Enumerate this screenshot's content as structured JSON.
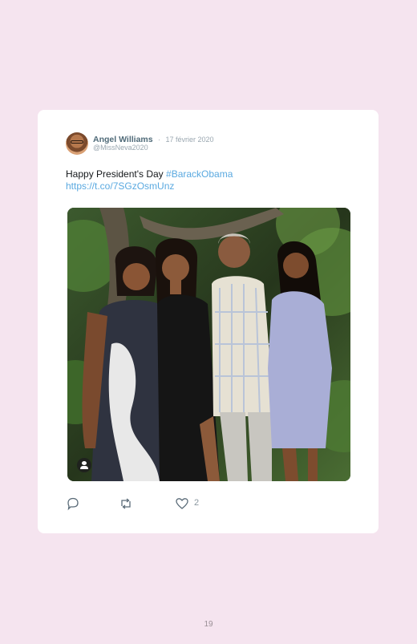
{
  "tweet": {
    "author_name": "Angel Williams",
    "separator": "·",
    "date": "17 février 2020",
    "handle": "@MissNeva2020",
    "text": "Happy President's Day ",
    "hashtag": "#BarackObama",
    "link": "https://t.co/7SGzOsmUnz",
    "like_count": "2"
  },
  "icons": {
    "reply": "reply-icon",
    "retweet": "retweet-icon",
    "like": "heart-icon",
    "tag": "person-tag-icon"
  },
  "colors": {
    "page_background": "#f5e4ef",
    "card_background": "#ffffff",
    "link": "#5aa9e0",
    "name": "#4f6a78",
    "meta": "#9aa7b0"
  },
  "page": {
    "number": "19"
  }
}
